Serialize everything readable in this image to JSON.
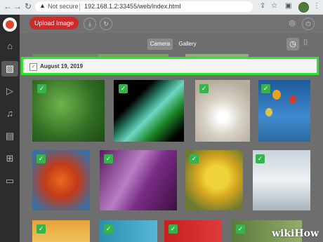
{
  "browser": {
    "not_secure": "Not secure",
    "url": "192.168.1.2:33455/web/index.html"
  },
  "toolbar": {
    "upload_label": "Upload Image"
  },
  "tabs": [
    {
      "label": "Camera",
      "active": true
    },
    {
      "label": "Gallery",
      "active": false
    }
  ],
  "gallery": {
    "date_label": "August 19, 2019"
  },
  "watermark": "wikiHow",
  "colors": {
    "accent": "#cc2b2b",
    "highlight": "#2ee52a",
    "check": "#37b24d"
  },
  "sidebar": {
    "items": [
      "home-icon",
      "image-icon",
      "video-icon",
      "music-icon",
      "document-icon",
      "apps-icon",
      "folder-icon"
    ]
  }
}
